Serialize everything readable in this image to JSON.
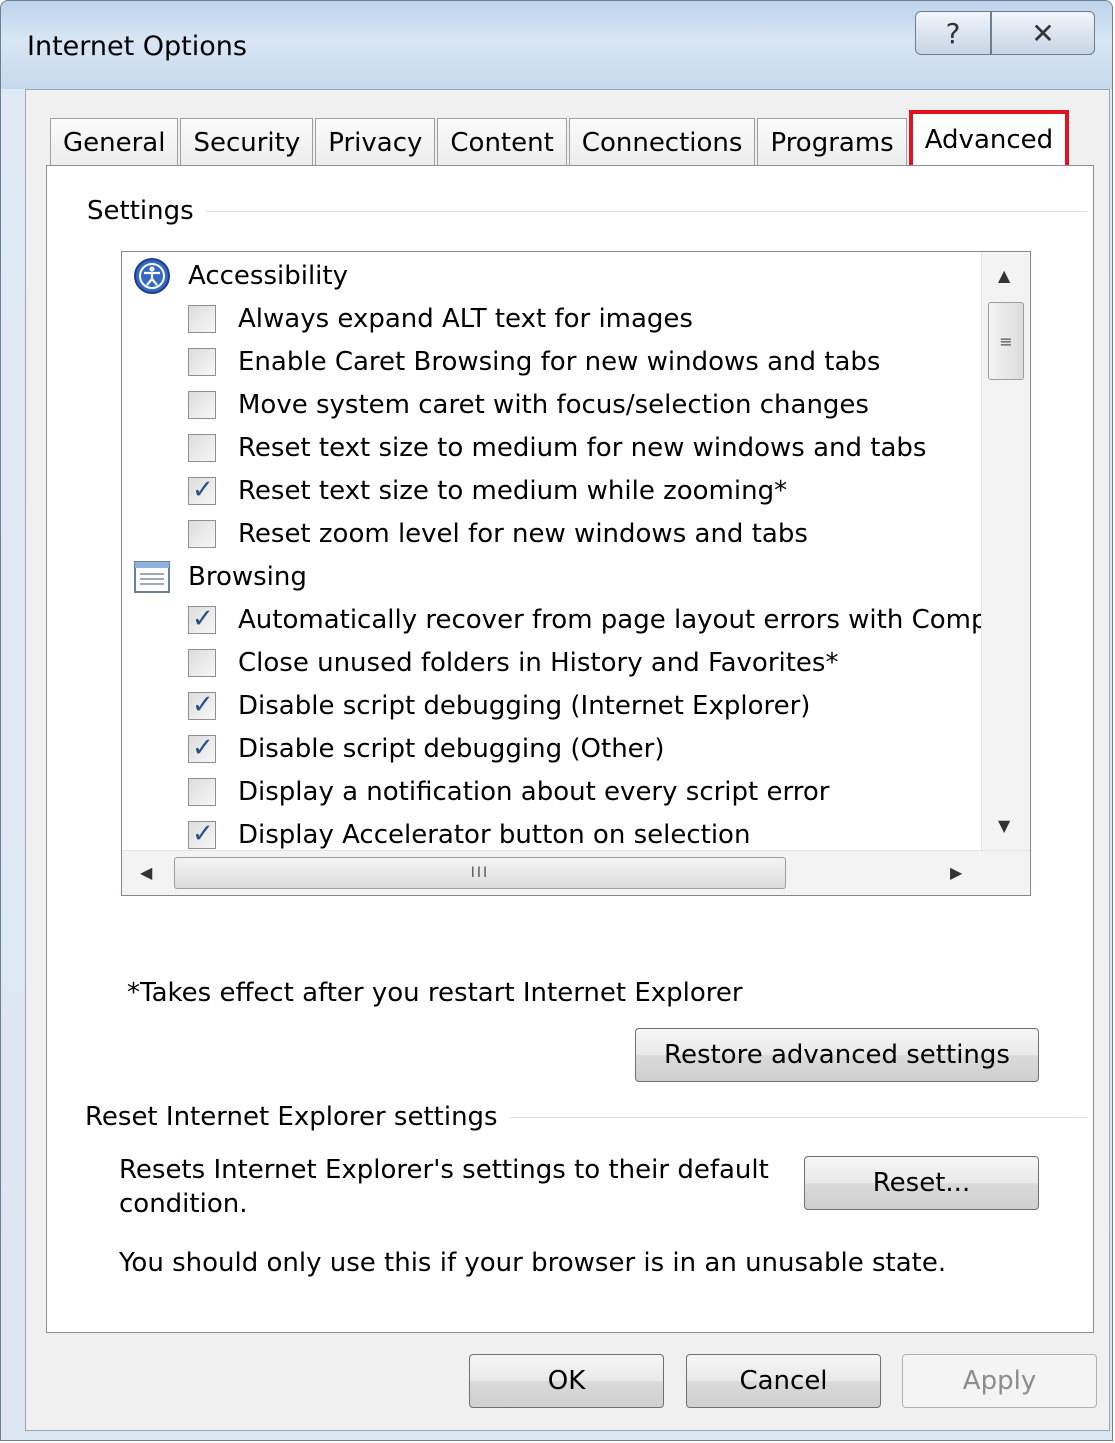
{
  "window": {
    "title": "Internet Options",
    "help_glyph": "?",
    "close_glyph": "✕"
  },
  "tabs": [
    {
      "label": "General"
    },
    {
      "label": "Security"
    },
    {
      "label": "Privacy"
    },
    {
      "label": "Content"
    },
    {
      "label": "Connections"
    },
    {
      "label": "Programs"
    },
    {
      "label": "Advanced",
      "active": true
    }
  ],
  "settings_group": {
    "title": "Settings",
    "categories": [
      {
        "label": "Accessibility",
        "icon": "accessibility-icon",
        "items": [
          {
            "label": "Always expand ALT text for images",
            "checked": false
          },
          {
            "label": "Enable Caret Browsing for new windows and tabs",
            "checked": false
          },
          {
            "label": "Move system caret with focus/selection changes",
            "checked": false
          },
          {
            "label": "Reset text size to medium for new windows and tabs",
            "checked": false
          },
          {
            "label": "Reset text size to medium while zooming*",
            "checked": true
          },
          {
            "label": "Reset zoom level for new windows and tabs",
            "checked": false
          }
        ]
      },
      {
        "label": "Browsing",
        "icon": "browsing-page-icon",
        "items": [
          {
            "label": "Automatically recover from page layout errors with Compa",
            "checked": true
          },
          {
            "label": "Close unused folders in History and Favorites*",
            "checked": false
          },
          {
            "label": "Disable script debugging (Internet Explorer)",
            "checked": true
          },
          {
            "label": "Disable script debugging (Other)",
            "checked": true
          },
          {
            "label": "Display a notification about every script error",
            "checked": false
          },
          {
            "label": "Display Accelerator button on selection",
            "checked": true
          }
        ]
      }
    ],
    "hscroll_grip": "III",
    "restart_note": "*Takes effect after you restart Internet Explorer",
    "restore_button": "Restore advanced settings"
  },
  "reset_group": {
    "title": "Reset Internet Explorer settings",
    "description_line1": "Resets Internet Explorer's settings to their default",
    "description_line2": "condition.",
    "reset_button": "Reset...",
    "warning": "You should only use this if your browser is in an unusable state."
  },
  "footer": {
    "ok": "OK",
    "cancel": "Cancel",
    "apply": "Apply"
  },
  "colors": {
    "highlight": "#e0141e",
    "check": "#2c4f86"
  }
}
